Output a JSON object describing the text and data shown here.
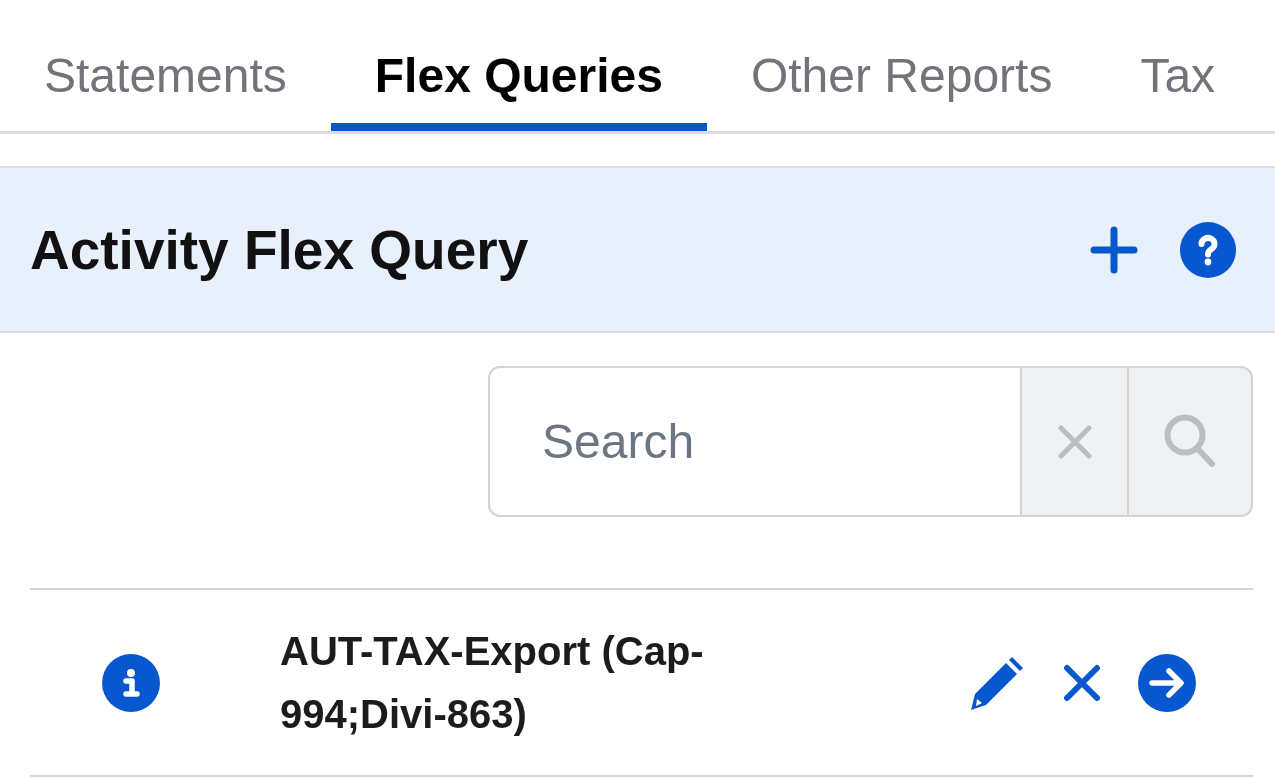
{
  "tabs": [
    {
      "label": "Statements",
      "selected": false
    },
    {
      "label": "Flex Queries",
      "selected": true
    },
    {
      "label": "Other Reports",
      "selected": false
    },
    {
      "label": "Tax",
      "selected": false
    }
  ],
  "panel": {
    "title": "Activity Flex Query"
  },
  "search": {
    "placeholder": "Search"
  },
  "queries": [
    {
      "name": "AUT-TAX-Export (Cap-994;Divi-863)"
    }
  ]
}
